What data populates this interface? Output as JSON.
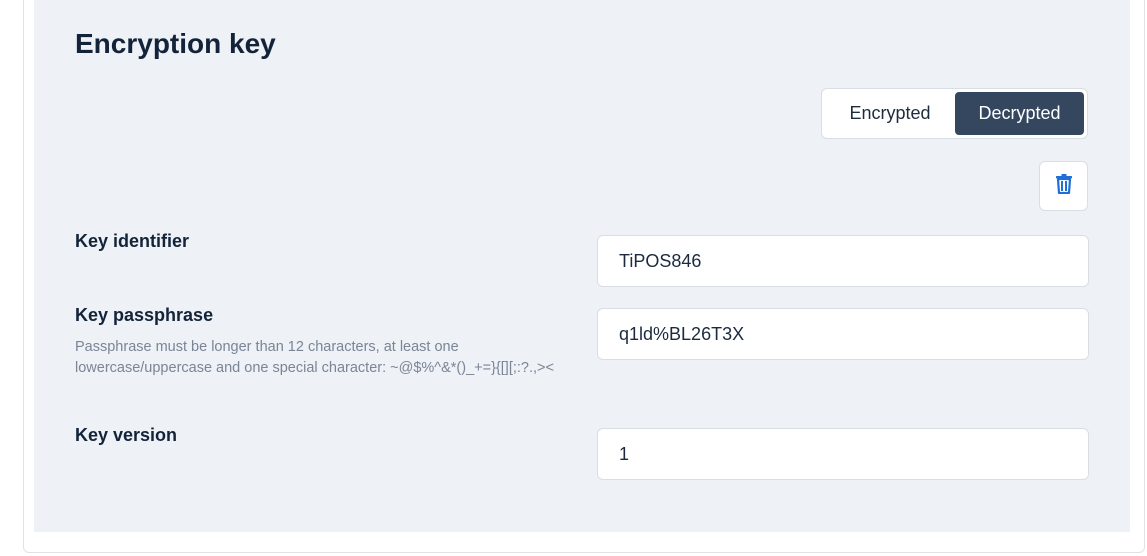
{
  "section": {
    "title": "Encryption key"
  },
  "toggle": {
    "encrypted_label": "Encrypted",
    "decrypted_label": "Decrypted",
    "selected": "Decrypted"
  },
  "delete_button": {
    "icon": "trash-icon"
  },
  "fields": {
    "key_identifier": {
      "label": "Key identifier",
      "value": "TiPOS846"
    },
    "key_passphrase": {
      "label": "Key passphrase",
      "help": "Passphrase must be longer than 12 characters, at least one lowercase/uppercase and one special character: ~@$%^&*()_+=}{[][;:?.,><",
      "value": "q1ld%BL26T3X"
    },
    "key_version": {
      "label": "Key version",
      "value": "1"
    }
  },
  "colors": {
    "panel_background": "#eef1f6",
    "toggle_active": "#34475f",
    "icon_accent": "#1f6fd6"
  }
}
